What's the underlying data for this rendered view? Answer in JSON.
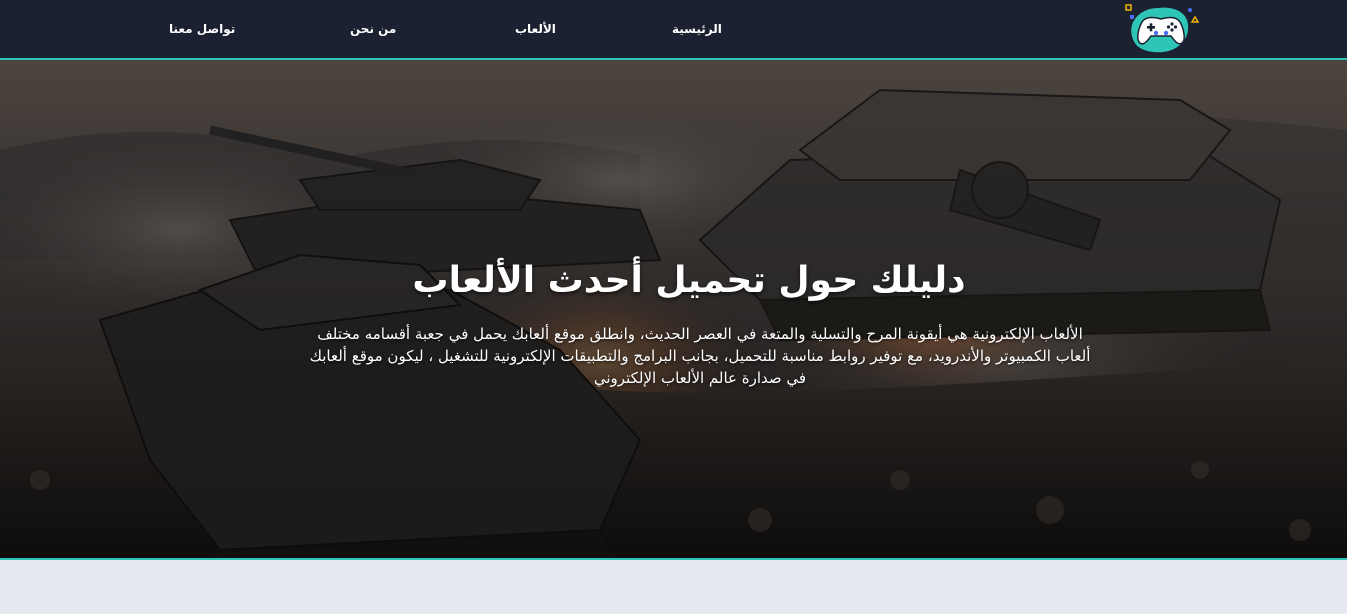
{
  "nav": {
    "home": "الرئيسية",
    "games": "الألعاب",
    "about": "من نحن",
    "contact": "تواصل معنا"
  },
  "logo": {
    "icon": "gamepad-icon",
    "accent": "#2ec4b6"
  },
  "hero": {
    "title": "دليلك حول تحميل أحدث الألعاب",
    "text": "الألعاب الإلكترونية هي أيقونة المرح والتسلية والمتعة في العصر الحديث، وانطلق موقع ألعابك يحمل في جعبة أقسامه مختلف ألعاب الكمبيوتر والأندرويد، مع توفير روابط مناسبة للتحميل، بجانب البرامج والتطبيقات الإلكترونية للتشغيل ، ليكون موقع ألعابك في صدارة عالم الألعاب الإلكتروني"
  },
  "colors": {
    "nav_bg": "#1b2130",
    "accent": "#2ec4b6",
    "page_bg": "#e6e9ef"
  }
}
